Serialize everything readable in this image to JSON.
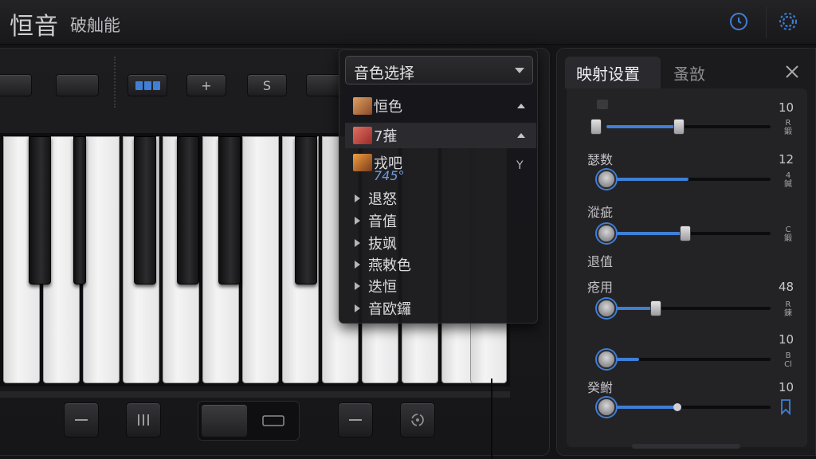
{
  "header": {
    "title": "恒音",
    "subtitle": "破舢能",
    "icons": [
      "clock-icon",
      "gear-icon"
    ]
  },
  "toolbar": {
    "plus_label": "+",
    "s_label": "S"
  },
  "voice_dropdown": {
    "selected": "音色选择",
    "items": [
      {
        "label": "恒色",
        "thumb_color": "#b8724a",
        "expanded": true
      },
      {
        "label": "7蓷",
        "thumb_color": "#c95a4a",
        "expanded": true,
        "highlighted": true
      },
      {
        "label": "戎吧",
        "thumb_color": "#d88a3a",
        "expanded": false
      },
      {
        "label": "退怒",
        "expanded": false
      },
      {
        "label": "音值",
        "expanded": false
      },
      {
        "label": "抜飒",
        "expanded": false
      },
      {
        "label": "燕敕色",
        "expanded": false
      },
      {
        "label": "迭恒",
        "expanded": false
      },
      {
        "label": "音欧鑼",
        "expanded": false
      }
    ],
    "item3_sub": "745°",
    "item3_extra": "Y"
  },
  "right_panel": {
    "tabs": [
      {
        "label": "映射设置",
        "active": true
      },
      {
        "label": "蚤敨",
        "active": false
      }
    ],
    "params": [
      {
        "label": "",
        "value": "10",
        "unit": "R\n鍛",
        "level": 0.44,
        "range_start": 0.0
      },
      {
        "label": "瑟数",
        "value": "12",
        "unit": "4\n鍼",
        "level": 0.5,
        "range_start": 0.0
      },
      {
        "label": "漎疵",
        "value": "",
        "unit": "C\n鍛",
        "level": 0.48,
        "range_start": 0.0
      },
      {
        "label": "退值",
        "value": "",
        "unit": "",
        "level": null,
        "range_start": null
      },
      {
        "label": "疮用",
        "value": "48",
        "unit": "R\n鍊",
        "level": 0.3,
        "range_start": 0.0
      },
      {
        "label": "",
        "value": "10",
        "unit": "B\nCl",
        "level": 0.2,
        "range_start": 0.0
      },
      {
        "label": "癸鲋",
        "value": "10",
        "unit": "",
        "level": 0.43,
        "range_start": 0.0
      }
    ]
  },
  "colors": {
    "accent": "#3f7fd6",
    "background": "#141416",
    "panel": "#1b1b1e"
  }
}
